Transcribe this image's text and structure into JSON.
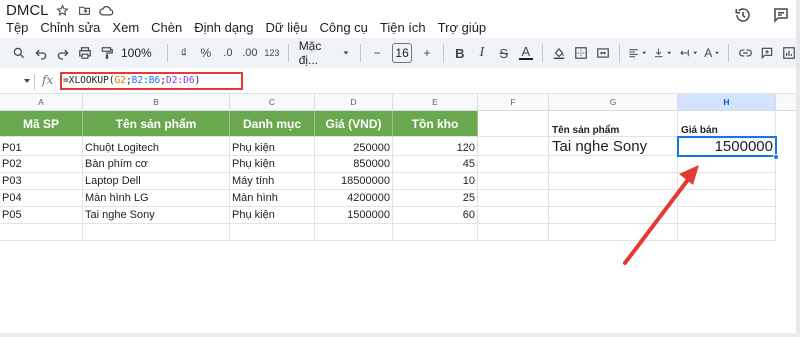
{
  "app": {
    "doc_title": "DMCL"
  },
  "menu": [
    "Tệp",
    "Chỉnh sửa",
    "Xem",
    "Chèn",
    "Định dạng",
    "Dữ liệu",
    "Công cụ",
    "Tiện ích",
    "Trợ giúp"
  ],
  "toolbar": {
    "zoom": "100%",
    "percent": "%",
    "decimal_decrease": ".0",
    "decimal_increase": ".00",
    "number_format": "123",
    "font": "Mặc đị...",
    "font_size": "16"
  },
  "formula_bar": {
    "fx": "fx",
    "formula": {
      "fn": "=XLOOKUP(",
      "arg1": "G2",
      "sep1": ";",
      "arg2": "B2:B6",
      "sep2": ";",
      "arg3": "D2:D6",
      "close": ")"
    }
  },
  "columns": [
    "A",
    "B",
    "C",
    "D",
    "E",
    "F",
    "G",
    "H"
  ],
  "table": {
    "headers": [
      "Mã SP",
      "Tên sản phẩm",
      "Danh mục",
      "Giá (VND)",
      "Tồn kho"
    ],
    "rows": [
      [
        "P01",
        "Chuột Logitech",
        "Phụ kiện",
        "250000",
        "120"
      ],
      [
        "P02",
        "Bàn phím cơ",
        "Phụ kiện",
        "850000",
        "45"
      ],
      [
        "P03",
        "Laptop Dell",
        "Máy tính",
        "18500000",
        "10"
      ],
      [
        "P04",
        "Màn hình LG",
        "Màn hình",
        "4200000",
        "25"
      ],
      [
        "P05",
        "Tai nghe Sony",
        "Phụ kiện",
        "1500000",
        "60"
      ]
    ]
  },
  "lookup": {
    "label_product": "Tên sản phẩm",
    "label_price": "Giá bán",
    "product_value": "Tai nghe Sony",
    "price_value": "1500000"
  },
  "colors": {
    "header_green": "#6aa84f",
    "formula_highlight": "#e53935",
    "selection_blue": "#1a73e8",
    "arrow_red": "#e53935"
  }
}
